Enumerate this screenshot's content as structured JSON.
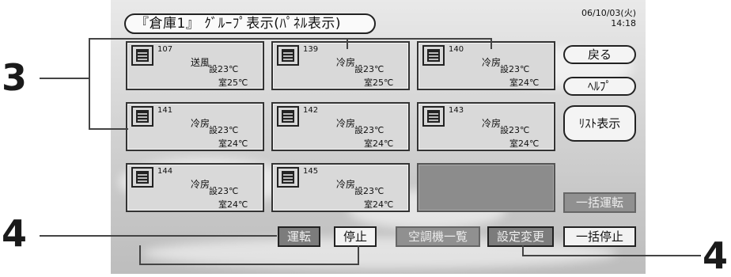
{
  "header": {
    "title": "『倉庫1』 ｸﾞﾙｰﾌﾟ表示(ﾊﾟﾈﾙ表示)",
    "date": "06/10/03(火)",
    "time": "14:18"
  },
  "panels": [
    {
      "number": "107",
      "mode": "送風",
      "set_temp": "設23℃",
      "room_temp": "室25℃"
    },
    {
      "number": "139",
      "mode": "冷房",
      "set_temp": "設23℃",
      "room_temp": "室25℃"
    },
    {
      "number": "140",
      "mode": "冷房",
      "set_temp": "設23℃",
      "room_temp": "室24℃"
    },
    {
      "number": "141",
      "mode": "冷房",
      "set_temp": "設23℃",
      "room_temp": "室24℃"
    },
    {
      "number": "142",
      "mode": "冷房",
      "set_temp": "設23℃",
      "room_temp": "室24℃"
    },
    {
      "number": "143",
      "mode": "冷房",
      "set_temp": "設23℃",
      "room_temp": "室24℃"
    },
    {
      "number": "144",
      "mode": "冷房",
      "set_temp": "設23℃",
      "room_temp": "室24℃"
    },
    {
      "number": "145",
      "mode": "冷房",
      "set_temp": "設23℃",
      "room_temp": "室24℃"
    }
  ],
  "side_buttons": {
    "back": "戻る",
    "help": "ﾍﾙﾌﾟ",
    "list_view": "ﾘｽﾄ表示",
    "all_run": "一括運転",
    "all_stop": "一括停止"
  },
  "bottom_buttons": {
    "run": "運転",
    "stop": "停止",
    "unit_list": "空調機一覧",
    "settings_change": "設定変更"
  },
  "callouts": {
    "c3": "3",
    "c4_left": "4",
    "c4_right": "4"
  },
  "colors": {
    "panel_bg": "#d9d9d9",
    "empty_panel": "#8c8c8c",
    "disabled_button": "#909090"
  }
}
